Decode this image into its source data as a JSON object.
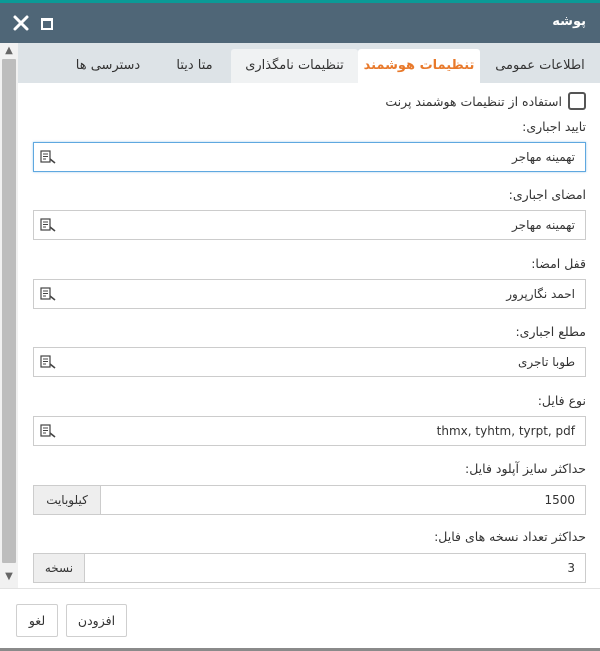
{
  "window": {
    "title": "پوشه"
  },
  "tabs": [
    {
      "label": "اطلاعات عمومی"
    },
    {
      "label": "تنظیمات هوشمند",
      "active": true
    },
    {
      "label": "تنظیمات نامگذاری"
    },
    {
      "label": "متا دیتا"
    },
    {
      "label": "دسترسی ها"
    }
  ],
  "smart_settings": {
    "inherit_checkbox": {
      "label": "استفاده از تنظیمات هوشمند پرنت",
      "checked": false
    },
    "fields": [
      {
        "label": "تایید اجباری:",
        "value": "تهمینه مهاجر"
      },
      {
        "label": "امضای اجباری:",
        "value": "تهمینه مهاجر"
      },
      {
        "label": "قفل امضا:",
        "value": "احمد نگارپرور"
      },
      {
        "label": "مطلع اجباری:",
        "value": "طوبا تاجری"
      },
      {
        "label": "نوع فایل:",
        "value": "thmx, tyhtm, tyrpt, pdf"
      }
    ],
    "max_upload": {
      "label": "حداکثر سایز آپلود فایل:",
      "value": "1500",
      "unit": "کیلوبایت"
    },
    "max_versions": {
      "label": "حداکثر تعداد نسخه های فایل:",
      "value": "3",
      "unit": "نسخه"
    }
  },
  "footer": {
    "add_label": "افزودن",
    "cancel_label": "لغو"
  },
  "colors": {
    "titlebar": "#4f6677",
    "accent_line": "#0b9a96",
    "active_tab": "#e8792b",
    "tab_bar": "#dde3e7"
  },
  "icons": {
    "close": "close-icon",
    "maximize": "maximize-icon",
    "picker": "user-picker-icon"
  }
}
